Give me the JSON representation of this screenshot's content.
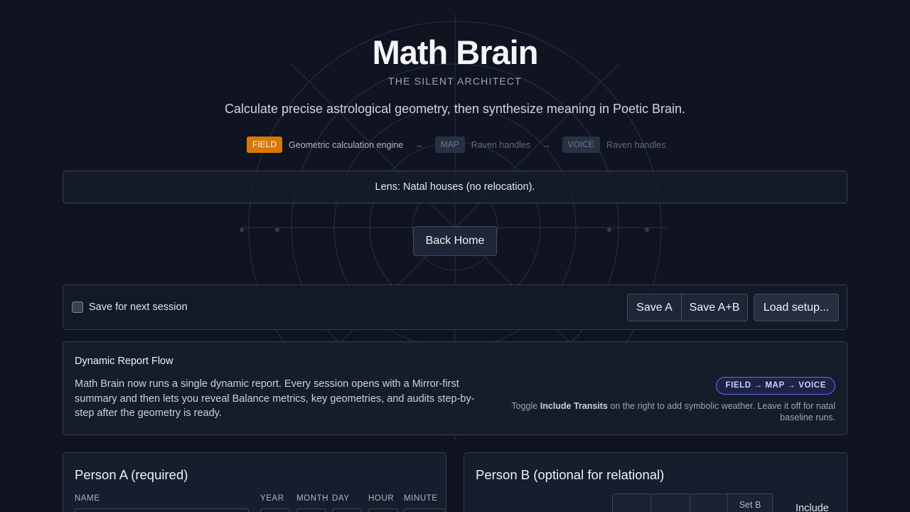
{
  "header": {
    "title": "Math Brain",
    "subtitle": "THE SILENT ARCHITECT",
    "tagline": "Calculate precise astrological geometry, then synthesize meaning in Poetic Brain."
  },
  "pipeline": {
    "arrow": "→",
    "steps": [
      {
        "label": "FIELD",
        "desc": "Geometric calculation engine",
        "active": true
      },
      {
        "label": "MAP",
        "desc": "Raven handles",
        "active": false
      },
      {
        "label": "VOICE",
        "desc": "Raven handles",
        "active": false
      }
    ]
  },
  "lens": {
    "text": "Lens: Natal houses (no relocation)."
  },
  "back_button": {
    "label": "Back Home"
  },
  "session": {
    "checkbox_label": "Save for next session",
    "checked": false,
    "save_a_label": "Save A",
    "save_ab_label": "Save A+B",
    "load_label": "Load setup..."
  },
  "flow": {
    "title": "Dynamic Report Flow",
    "body": "Math Brain now runs a single dynamic report. Every session opens with a Mirror-first summary and then lets you reveal Balance metrics, key geometries, and audits step-by-step after the geometry is ready.",
    "badge": "FIELD → MAP → VOICE",
    "note_prefix": "Toggle ",
    "note_bold": "Include Transits",
    "note_suffix": " on the right to add symbolic weather. Leave it off for natal baseline runs."
  },
  "person_a": {
    "title": "Person A (required)",
    "labels": {
      "name": "NAME",
      "year": "YEAR",
      "month": "MONTH",
      "day": "DAY",
      "hour": "HOUR",
      "minute": "MINUTE"
    }
  },
  "person_b": {
    "title": "Person B (optional for relational)",
    "set_label": "Set B",
    "include_label": "Include"
  },
  "colors": {
    "background": "#0f1420",
    "field_accent": "#d97706",
    "badge_accent": "#6366f1"
  }
}
